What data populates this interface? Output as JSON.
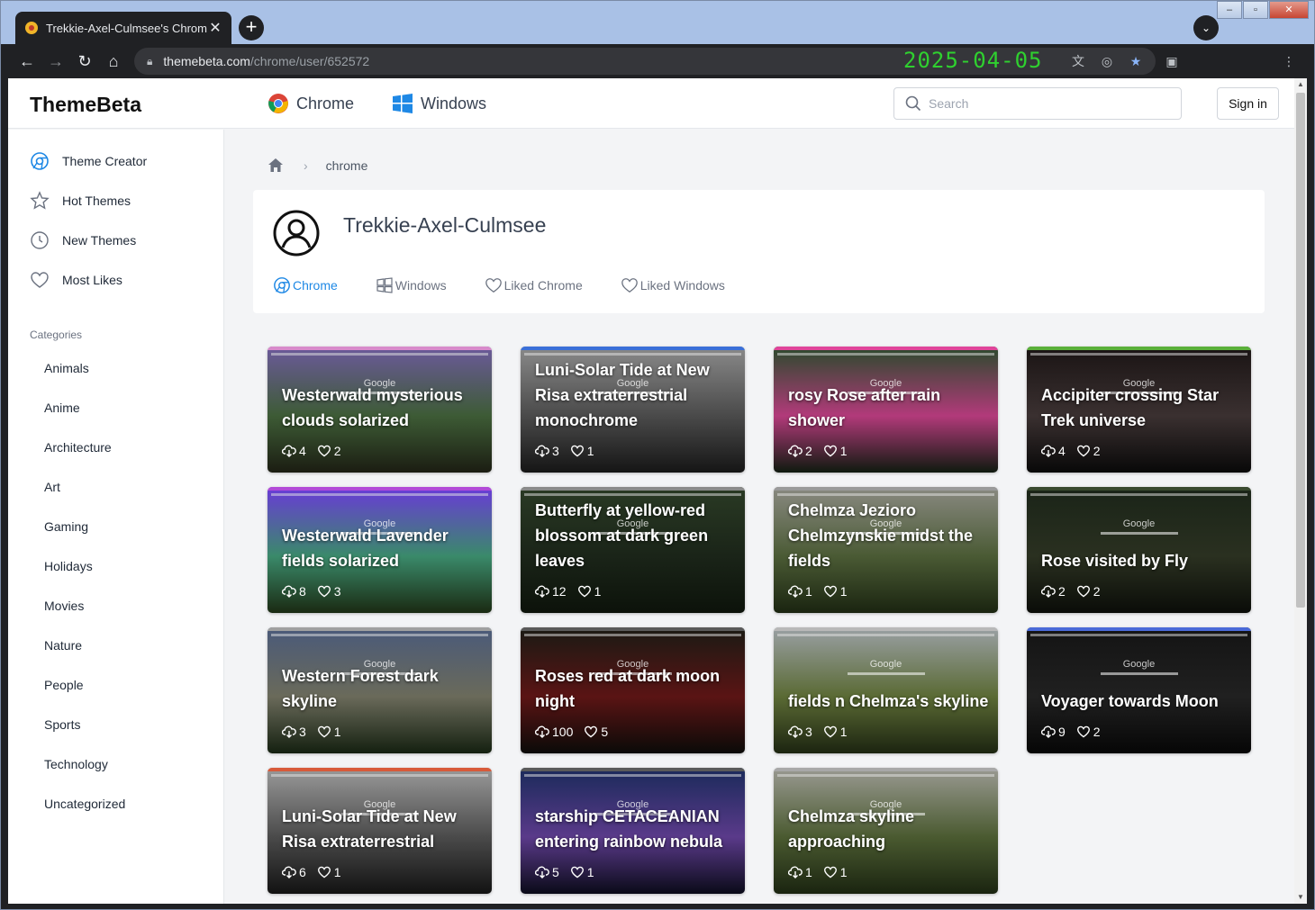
{
  "browser": {
    "tab_title": "Trekkie-Axel-Culmsee's Chrom",
    "url_host": "themebeta.com",
    "url_path": "/chrome/user/652572",
    "date_overlay": "2025-04-05"
  },
  "header": {
    "logo": "ThemeBeta",
    "nav": [
      {
        "label": "Chrome",
        "icon": "chrome-icon"
      },
      {
        "label": "Windows",
        "icon": "windows-icon"
      }
    ],
    "search_placeholder": "Search",
    "signin": "Sign in"
  },
  "sidebar": {
    "items": [
      {
        "label": "Theme Creator",
        "icon": "chrome-outline-icon"
      },
      {
        "label": "Hot Themes",
        "icon": "star-icon"
      },
      {
        "label": "New Themes",
        "icon": "clock-icon"
      },
      {
        "label": "Most Likes",
        "icon": "heart-icon"
      }
    ],
    "categories_title": "Categories",
    "categories": [
      "Animals",
      "Anime",
      "Architecture",
      "Art",
      "Gaming",
      "Holidays",
      "Movies",
      "Nature",
      "People",
      "Sports",
      "Technology",
      "Uncategorized"
    ]
  },
  "breadcrumb": {
    "current": "chrome"
  },
  "profile": {
    "username": "Trekkie-Axel-Culmsee",
    "tabs": [
      {
        "label": "Chrome",
        "active": true
      },
      {
        "label": "Windows",
        "active": false
      },
      {
        "label": "Liked Chrome",
        "active": false
      },
      {
        "label": "Liked Windows",
        "active": false
      }
    ]
  },
  "themes": [
    {
      "title": "Westerwald mysterious clouds solarized",
      "downloads": "4",
      "likes": "2",
      "colors": [
        "#6c5a9c",
        "#3d5b35",
        "#1b1d12"
      ],
      "bar": "#d88acb"
    },
    {
      "title": "Luni-Solar Tide at New Risa extraterrestrial monochrome",
      "downloads": "3",
      "likes": "1",
      "colors": [
        "#8a8a8a",
        "#4a4a4a",
        "#151515"
      ],
      "bar": "#3a6fd8"
    },
    {
      "title": "rosy Rose after rain shower",
      "downloads": "2",
      "likes": "1",
      "colors": [
        "#2a4a2c",
        "#b23a7a",
        "#0f1a0f"
      ],
      "bar": "#e0449a"
    },
    {
      "title": "Accipiter crossing Star Trek universe",
      "downloads": "4",
      "likes": "2",
      "colors": [
        "#1a1414",
        "#3a3030",
        "#080808"
      ],
      "bar": "#5ab03a"
    },
    {
      "title": "Westerwald Lavender fields solarized",
      "downloads": "8",
      "likes": "3",
      "colors": [
        "#6a3ad8",
        "#3a8a6a",
        "#1a2a12"
      ],
      "bar": "#b24ad8"
    },
    {
      "title": "Butterfly at yellow-red blossom at dark green leaves",
      "downloads": "12",
      "likes": "1",
      "colors": [
        "#2a3a24",
        "#1a2418",
        "#0c120a"
      ],
      "bar": "#8a8a8a"
    },
    {
      "title": "Chelmza Jezioro Chelmzynskie midst the fields",
      "downloads": "1",
      "likes": "1",
      "colors": [
        "#8a8a82",
        "#4a5a34",
        "#1a2410"
      ],
      "bar": "#9a9a9a"
    },
    {
      "title": "Rose visited by Fly",
      "downloads": "2",
      "likes": "2",
      "colors": [
        "#1a2418",
        "#2a3020",
        "#0a0c08"
      ],
      "bar": "#3a4a30"
    },
    {
      "title": "Western Forest dark skyline",
      "downloads": "3",
      "likes": "1",
      "colors": [
        "#4a5a7a",
        "#6a6a5a",
        "#142010"
      ],
      "bar": "#a0a0a0"
    },
    {
      "title": "Roses red at dark moon night",
      "downloads": "100",
      "likes": "5",
      "colors": [
        "#1a1a14",
        "#5a1414",
        "#0a0a08"
      ],
      "bar": "#5a5a5a"
    },
    {
      "title": "fields n Chelmza's skyline",
      "downloads": "3",
      "likes": "1",
      "colors": [
        "#9aa0a4",
        "#5a6a34",
        "#1c2410"
      ],
      "bar": "#b8b8b8"
    },
    {
      "title": "Voyager towards Moon",
      "downloads": "9",
      "likes": "2",
      "colors": [
        "#141414",
        "#202020",
        "#060606"
      ],
      "bar": "#4a6ad8"
    },
    {
      "title": "Luni-Solar Tide at New Risa extraterrestrial",
      "downloads": "6",
      "likes": "1",
      "colors": [
        "#9a9a9a",
        "#4a4a4a",
        "#121212"
      ],
      "bar": "#d85a3a"
    },
    {
      "title": "starship CETACEANIAN entering rainbow nebula",
      "downloads": "5",
      "likes": "1",
      "colors": [
        "#1a2a5a",
        "#5a3a8a",
        "#0a0a18"
      ],
      "bar": "#5a5a5a"
    },
    {
      "title": "Chelmza skyline approaching",
      "downloads": "1",
      "likes": "1",
      "colors": [
        "#9a9a92",
        "#4a5a30",
        "#1a2410"
      ],
      "bar": "#a8a8a8"
    }
  ],
  "card_google_label": "Google"
}
